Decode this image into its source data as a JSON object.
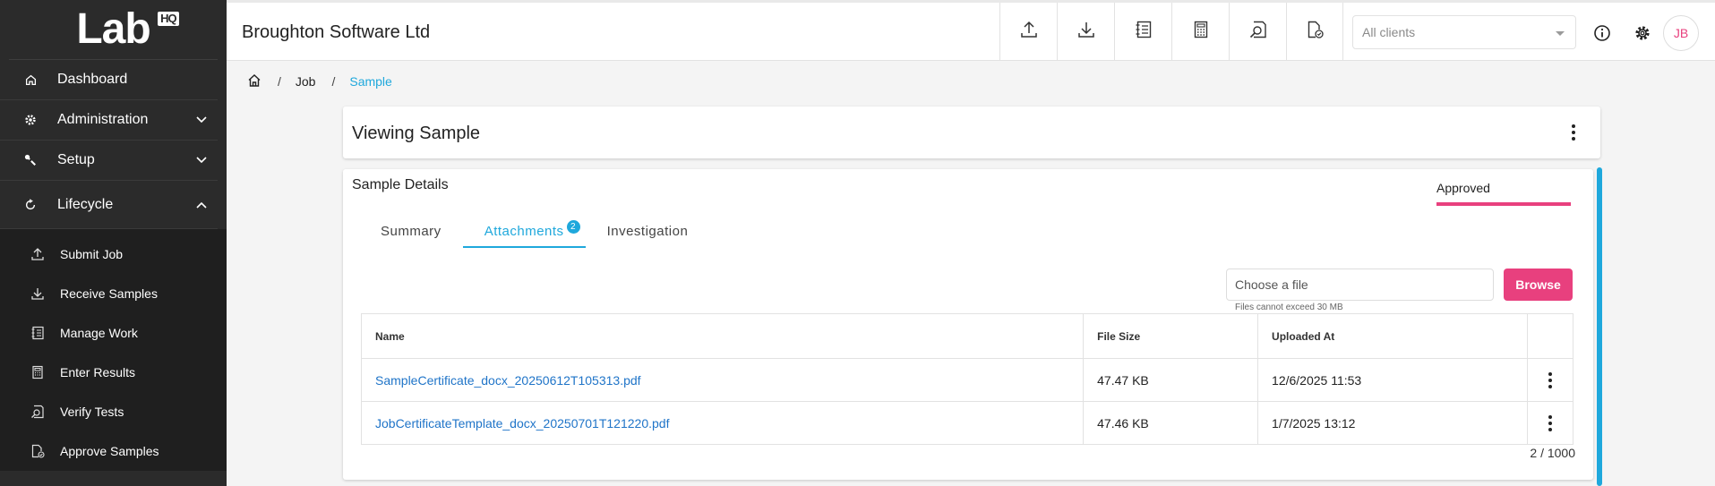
{
  "app": {
    "logo": "Lab",
    "logo_badge": "HQ",
    "company": "Broughton Software Ltd"
  },
  "sidebar": {
    "items": [
      {
        "label": "Dashboard",
        "icon": "home-icon"
      },
      {
        "label": "Administration",
        "icon": "gear-icon",
        "expandable": true
      },
      {
        "label": "Setup",
        "icon": "wrench-icon",
        "expandable": true
      },
      {
        "label": "Lifecycle",
        "icon": "cycle-icon",
        "expanded": true
      }
    ],
    "subitems": [
      {
        "label": "Submit Job",
        "icon": "upload-icon"
      },
      {
        "label": "Receive Samples",
        "icon": "download-icon"
      },
      {
        "label": "Manage Work",
        "icon": "notebook-icon"
      },
      {
        "label": "Enter Results",
        "icon": "calculator-icon"
      },
      {
        "label": "Verify Tests",
        "icon": "search-document-icon"
      },
      {
        "label": "Approve Samples",
        "icon": "approve-document-icon"
      }
    ]
  },
  "toolbar": {
    "client_placeholder": "All clients",
    "avatar_initials": "JB"
  },
  "breadcrumb": [
    "Job",
    "Sample"
  ],
  "page": {
    "title": "Viewing Sample",
    "details_title": "Sample Details",
    "status": "Approved",
    "tabs": [
      {
        "label": "Summary"
      },
      {
        "label": "Attachments",
        "badge": "2",
        "active": true
      },
      {
        "label": "Investigation"
      }
    ],
    "file_placeholder": "Choose a file",
    "file_hint": "Files cannot exceed 30 MB",
    "browse_label": "Browse",
    "table": {
      "headers": [
        "Name",
        "File Size",
        "Uploaded At"
      ],
      "rows": [
        {
          "name": "SampleCertificate_docx_20250612T105313.pdf",
          "size": "47.47 KB",
          "uploaded": "12/6/2025 11:53"
        },
        {
          "name": "JobCertificateTemplate_docx_20250701T121220.pdf",
          "size": "47.46 KB",
          "uploaded": "1/7/2025 13:12"
        }
      ]
    },
    "count": "2 / 1000"
  },
  "colors": {
    "sidebar_bg": "#2b2b2b",
    "accent_blue": "#1fa8dc",
    "accent_pink": "#e8407e",
    "link_blue": "#1f74c8"
  }
}
